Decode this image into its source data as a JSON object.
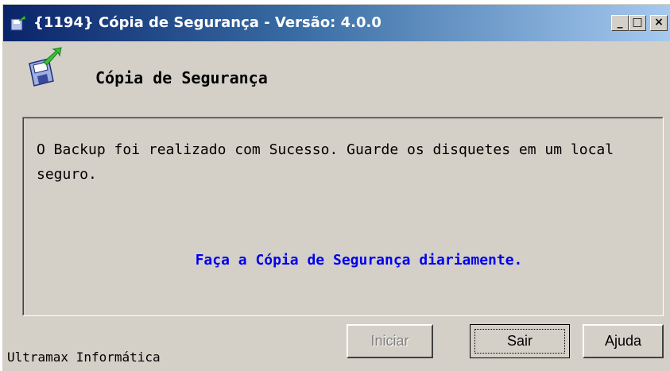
{
  "window": {
    "title": "{1194} Cópia de Segurança - Versão: 4.0.0",
    "controls": {
      "minimize": "_",
      "maximize": "□",
      "close": "×"
    }
  },
  "header": {
    "title": "Cópia de Segurança",
    "icon": "floppy-disk-green-arrow-icon"
  },
  "panel": {
    "message": "O Backup foi realizado com Sucesso. Guarde os disquetes em um local seguro.",
    "tip": "Faça a Cópia de Segurança diariamente."
  },
  "buttons": {
    "iniciar": {
      "label": "Iniciar",
      "enabled": false
    },
    "sair": {
      "label": "Sair",
      "default": true
    },
    "ajuda": {
      "label": "Ajuda"
    }
  },
  "footer": {
    "company": "Ultramax Informática"
  },
  "colors": {
    "titlebar_start": "#0a246a",
    "titlebar_end": "#a6caf0",
    "window_bg": "#d4d0c8",
    "tip_text": "#0000ee"
  }
}
